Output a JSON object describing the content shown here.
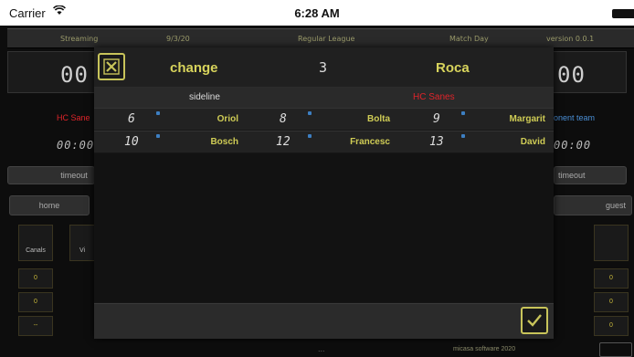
{
  "status_bar": {
    "carrier": "Carrier",
    "time": "6:28 AM"
  },
  "info_bar": {
    "streaming": "Streaming",
    "date": "9/3/20",
    "league": "Regular League",
    "match_day": "Match Day",
    "version": "version 0.0.1"
  },
  "background": {
    "home_score_left": "00",
    "guest_score_right": "00",
    "home_team_partial": "HC Sane",
    "opponent_partial": "onent team",
    "timer_left": "00:00",
    "timer_right": "00:00",
    "timeout_left": "timeout",
    "timeout_right": "timeout",
    "home_label": "home",
    "guest_label": "guest",
    "col_canals": "Canals",
    "col_vi": "Vi",
    "cells_left": [
      "0",
      "0",
      "--"
    ],
    "cells_right": [
      "0",
      "0",
      "0"
    ],
    "copyright": "micasa software 2020",
    "dots": "..."
  },
  "modal": {
    "title": "change",
    "number": "3",
    "player_name": "Roca",
    "sideline_label": "sideline",
    "team_name": "HC Sanes",
    "players": [
      {
        "number": "6",
        "name": "Oriol"
      },
      {
        "number": "8",
        "name": "Bolta"
      },
      {
        "number": "9",
        "name": "Margarit"
      },
      {
        "number": "10",
        "name": "Bosch"
      },
      {
        "number": "12",
        "name": "Francesc"
      },
      {
        "number": "13",
        "name": "David"
      }
    ]
  },
  "colors": {
    "accent_yellow": "#d8d45c",
    "team_red": "#e0242a",
    "marker_blue": "#3d7fc2",
    "background_dark": "#0d0d0d"
  },
  "icons": {
    "close": "close-x-icon",
    "confirm": "checkmark-icon",
    "wifi": "wifi-icon",
    "battery": "battery-icon"
  }
}
